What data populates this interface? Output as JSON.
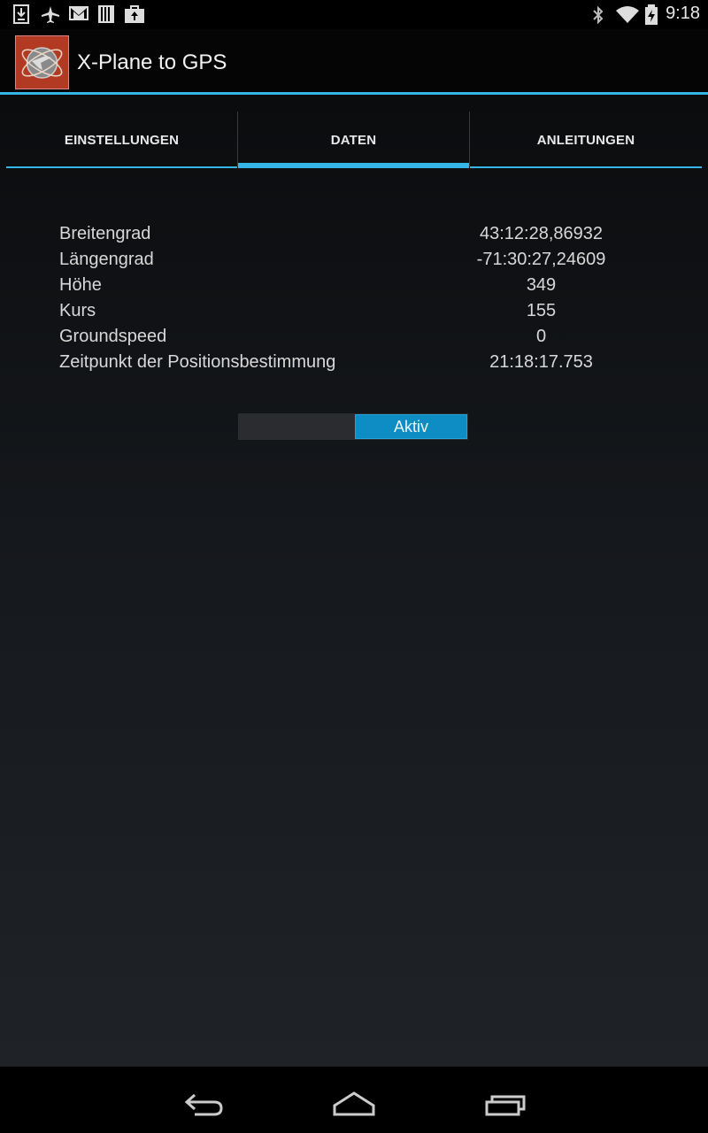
{
  "status_bar": {
    "time": "9:18",
    "left_icons": [
      "download-icon",
      "airplane-mode-icon",
      "gmail-icon",
      "sim-card-icon",
      "shopping-bag-icon"
    ],
    "right_icons": [
      "bluetooth-icon",
      "wifi-icon",
      "battery-charging-icon"
    ]
  },
  "app": {
    "title": "X-Plane to GPS"
  },
  "tabs": [
    {
      "label": "EINSTELLUNGEN",
      "selected": false
    },
    {
      "label": "DATEN",
      "selected": true
    },
    {
      "label": "ANLEITUNGEN",
      "selected": false
    }
  ],
  "data_rows": [
    {
      "label": "Breitengrad",
      "value": "43:12:28,86932"
    },
    {
      "label": "Längengrad",
      "value": "-71:30:27,24609"
    },
    {
      "label": "Höhe",
      "value": "349"
    },
    {
      "label": "Kurs",
      "value": "155"
    },
    {
      "label": "Groundspeed",
      "value": "0"
    },
    {
      "label": "Zeitpunkt der Positionsbestimmung",
      "value": "21:18:17.753"
    }
  ],
  "toggle": {
    "label": "Aktiv",
    "state": "on"
  },
  "nav_bar": {
    "buttons": [
      "back-icon",
      "home-icon",
      "recent-apps-icon"
    ]
  },
  "colors": {
    "accent": "#33b5e5",
    "toggle_on": "#0e8cc4"
  }
}
